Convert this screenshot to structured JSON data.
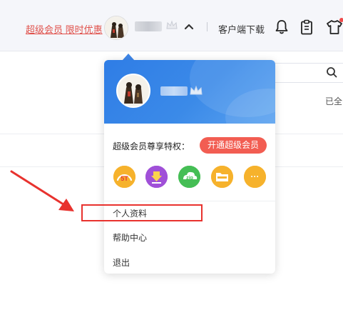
{
  "header": {
    "vip_promo": "超级会员 限时优惠",
    "client_download": "客户端下载",
    "icons": [
      "bell-icon",
      "clipboard-icon",
      "tshirt-icon",
      "chevron-up-icon",
      "crown-icon"
    ]
  },
  "background": {
    "side_text": "已全"
  },
  "dropdown": {
    "privilege_label": "超级会员尊享特权：",
    "open_vip_button": "开通超级会员",
    "perks": [
      {
        "icon": "speed-perk-icon",
        "text": "5T"
      },
      {
        "icon": "download-perk-icon",
        "text": ""
      },
      {
        "icon": "zip-perk-icon",
        "text": "zip"
      },
      {
        "icon": "folder-perk-icon",
        "text": ""
      },
      {
        "icon": "more-perk-icon",
        "text": "···"
      }
    ],
    "menu": {
      "profile": "个人资料",
      "help": "帮助中心",
      "logout": "退出"
    }
  },
  "colors": {
    "accent_red": "#e0514b",
    "header_blue": "#2f7de6",
    "vip_button": "#f25d52",
    "annotation_red": "#e8322e"
  }
}
